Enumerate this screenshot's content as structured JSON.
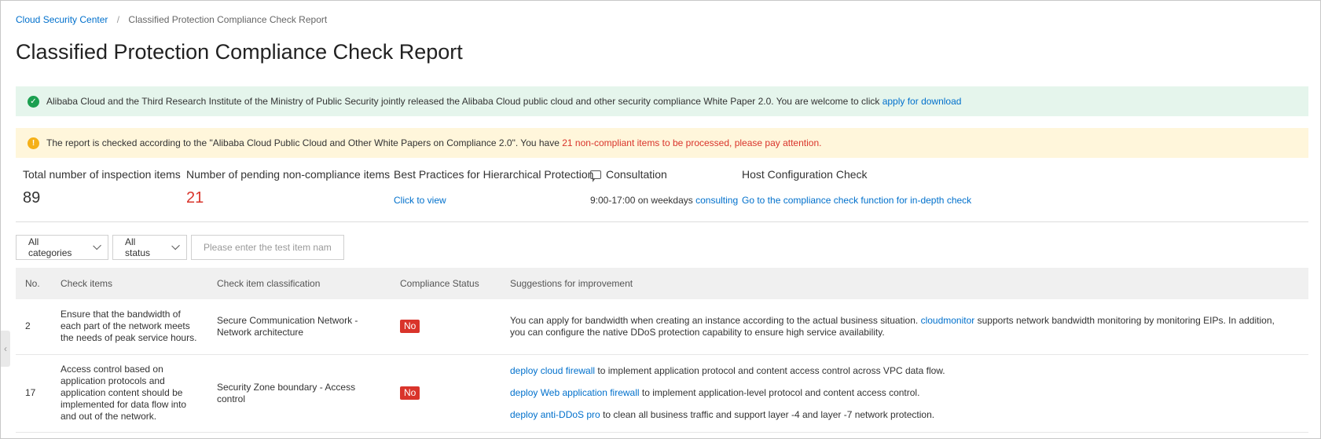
{
  "breadcrumb": {
    "root": "Cloud Security Center",
    "separator": "/",
    "current": "Classified Protection Compliance Check Report"
  },
  "page_title": "Classified Protection Compliance Check Report",
  "alerts": {
    "success": {
      "text": "Alibaba Cloud and the Third Research Institute of the Ministry of Public Security jointly released the Alibaba Cloud public cloud and other security compliance White Paper 2.0. You are welcome to click",
      "link": "apply for download"
    },
    "warning": {
      "text": "The report is checked according to the \"Alibaba Cloud Public Cloud and Other White Papers on Compliance 2.0\". You have",
      "highlight": "21 non-compliant items to be processed, please pay attention."
    }
  },
  "stats": {
    "total": {
      "label": "Total number of inspection items",
      "value": "89"
    },
    "pending": {
      "label": "Number of pending non-compliance items",
      "value": "21"
    },
    "best_practices": {
      "label": "Best Practices for Hierarchical Protection",
      "link": "Click to view"
    },
    "consultation": {
      "label": "Consultation",
      "hours": "9:00-17:00 on weekdays",
      "link": "consulting"
    },
    "host_check": {
      "label": "Host Configuration Check",
      "link": "Go to the compliance check function for in-depth check"
    }
  },
  "filters": {
    "category": "All categories",
    "status": "All status",
    "search_placeholder": "Please enter the test item name"
  },
  "table": {
    "headers": [
      "No.",
      "Check items",
      "Check item classification",
      "Compliance Status",
      "Suggestions for improvement"
    ],
    "rows": [
      {
        "no": "2",
        "item": "Ensure that the bandwidth of each part of the network meets the needs of peak service hours.",
        "classification": "Secure Communication Network - Network architecture",
        "status": "No",
        "suggestion_pre": "You can apply for bandwidth when creating an instance according to the actual business situation.",
        "suggestion_link": "cloudmonitor",
        "suggestion_post": "supports network bandwidth monitoring by monitoring EIPs. In addition, you can configure the native DDoS protection capability to ensure high service availability."
      },
      {
        "no": "17",
        "item": "Access control based on application protocols and application content should be implemented for data flow into and out of the network.",
        "classification": "Security Zone boundary - Access control",
        "status": "No",
        "suggestions": [
          {
            "link": "deploy cloud firewall",
            "text": "to implement application protocol and content access control across VPC data flow."
          },
          {
            "link": "deploy Web application firewall",
            "text": "to implement application-level protocol and content access control."
          },
          {
            "link": "deploy anti-DDoS pro",
            "text": "to clean all business traffic and support layer -4 and layer -7 network protection."
          }
        ]
      }
    ]
  },
  "colors": {
    "link": "#0070cc",
    "danger": "#d9342b",
    "success_bg": "#e5f5ec",
    "warning_bg": "#fff6db"
  }
}
